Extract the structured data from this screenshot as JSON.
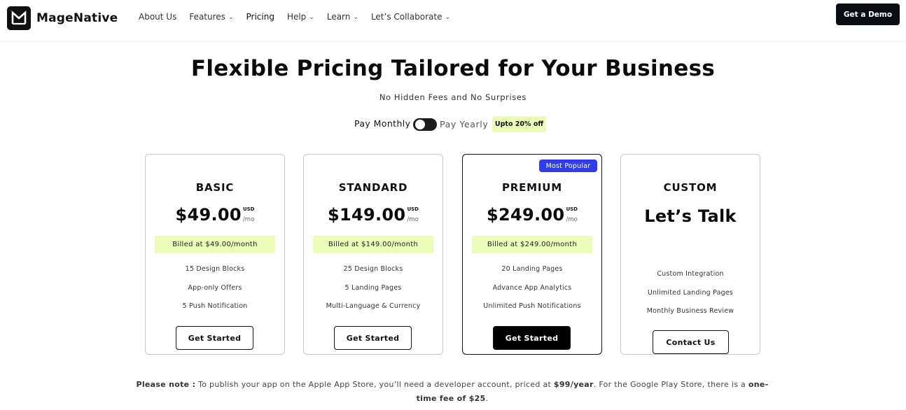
{
  "brand": {
    "name": "MageNative"
  },
  "nav": {
    "items": [
      {
        "label": "About Us",
        "has_dropdown": false
      },
      {
        "label": "Features",
        "has_dropdown": true
      },
      {
        "label": "Pricing",
        "has_dropdown": false
      },
      {
        "label": "Help",
        "has_dropdown": true
      },
      {
        "label": "Learn",
        "has_dropdown": true
      },
      {
        "label": "Let’s Collaborate",
        "has_dropdown": true
      }
    ],
    "demo_label": "Get a Demo"
  },
  "hero": {
    "title": "Flexible Pricing Tailored for Your Business",
    "subtitle": "No Hidden Fees and No Surprises"
  },
  "billing_toggle": {
    "monthly_label": "Pay Monthly",
    "yearly_label": "Pay Yearly",
    "discount_label": "Upto 20% off",
    "selected": "monthly"
  },
  "plans": [
    {
      "name": "BASIC",
      "price": "$49.00",
      "currency": "USD",
      "period": "/mo",
      "billed": "Billed at $49.00/month",
      "features": [
        "15 Design Blocks",
        "App-only Offers",
        "5 Push Notification"
      ],
      "cta": "Get Started"
    },
    {
      "name": "STANDARD",
      "price": "$149.00",
      "currency": "USD",
      "period": "/mo",
      "billed": "Billed at $149.00/month",
      "features": [
        "25 Design Blocks",
        "5 Landing Pages",
        "Multi-Language & Currency"
      ],
      "cta": "Get Started"
    },
    {
      "name": "PREMIUM",
      "badge": "Most Popular",
      "price": "$249.00",
      "currency": "USD",
      "period": "/mo",
      "billed": "Billed at $249.00/month",
      "features": [
        "20 Landing Pages",
        "Advance App Analytics",
        "Unlimited Push Notifications"
      ],
      "cta": "Get Started"
    },
    {
      "name": "CUSTOM",
      "headline": "Let’s Talk",
      "features": [
        "Custom Integration",
        "Unlimited Landing Pages",
        "Monthly Business Review"
      ],
      "cta": "Contact Us"
    }
  ],
  "note": {
    "lead": "Please note :",
    "text_1": " To publish your app on the Apple App Store, you’ll need a developer account, priced at ",
    "apple_price": "$99/year",
    "text_2": ". For the Google Play Store, there is a ",
    "google_fee": "one-time fee of $25",
    "text_3": "."
  },
  "colors": {
    "accent_green": "#eafcb8",
    "badge_blue": "#2f3ee8",
    "dark": "#0b0d14"
  }
}
